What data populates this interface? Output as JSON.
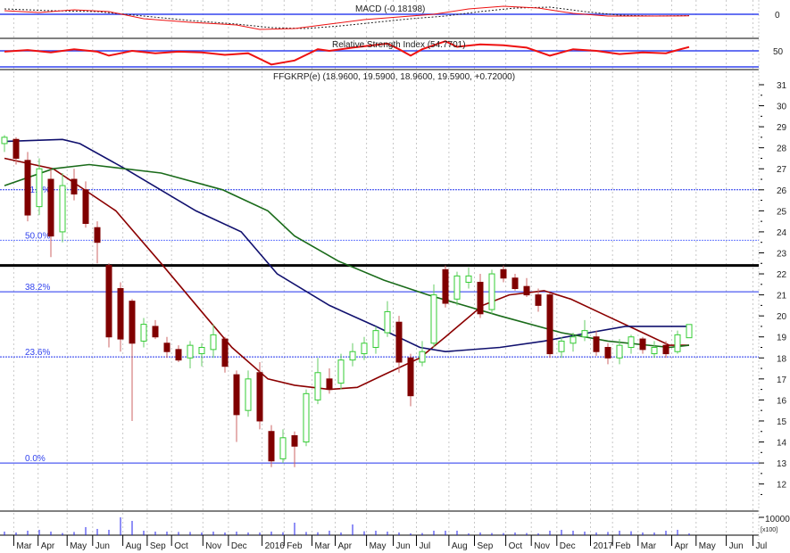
{
  "chart_data": {
    "type": "candlestick",
    "symbol_label": "FFGKRP(e) (18.9600, 19.5900, 18.9600, 19.5900, +0.72000)",
    "macd_label": "MACD (-0.18198)",
    "rsi_label": "Relative Strength Index (54.7701)",
    "price_axis": {
      "min": 12,
      "max": 31,
      "ticks": [
        12,
        13,
        14,
        15,
        16,
        17,
        18,
        19,
        20,
        21,
        22,
        23,
        24,
        25,
        26,
        27,
        28,
        29,
        30,
        31
      ]
    },
    "macd_axis": {
      "ticks": [
        {
          "label": "0",
          "value": 0
        }
      ]
    },
    "rsi_axis": {
      "ticks": [
        {
          "label": "50",
          "value": 50
        }
      ],
      "lines": [
        50,
        30
      ]
    },
    "volume_axis": {
      "tick_label": "10000",
      "tick_value": 10000,
      "unit_label": "[x100]"
    },
    "x_ticks": [
      [
        "Mar",
        0.8
      ],
      [
        "Apr",
        2.9
      ],
      [
        "May",
        5.4
      ],
      [
        "Jun",
        7.6
      ],
      [
        "Aug",
        10.2
      ],
      [
        "Sep",
        12.3
      ],
      [
        "Oct",
        14.4
      ],
      [
        "Nov",
        17.1
      ],
      [
        "Dec",
        19.3
      ],
      [
        "2016",
        22.2
      ],
      [
        "Feb",
        24.1
      ],
      [
        "Mar",
        26.5
      ],
      [
        "Apr",
        28.5
      ],
      [
        "May",
        31.2
      ],
      [
        "Jun",
        33.5
      ],
      [
        "Jul",
        35.5
      ],
      [
        "Aug",
        38.3
      ],
      [
        "Sep",
        40.5
      ],
      [
        "Oct",
        43.2
      ],
      [
        "Nov",
        45.4
      ],
      [
        "Dec",
        47.6
      ],
      [
        "2017",
        50.5
      ],
      [
        "Feb",
        52.4
      ],
      [
        "Mar",
        54.6
      ],
      [
        "Apr",
        57.5
      ],
      [
        "May",
        59.6
      ],
      [
        "Jun",
        62.2
      ],
      [
        "Jul",
        64.5
      ]
    ],
    "fibonacci": [
      {
        "label": "61.8%",
        "value": 26.0,
        "style": "dotted"
      },
      {
        "label": "50.0%",
        "value": 23.6,
        "style": "dotted-light"
      },
      {
        "label": "38.2%",
        "value": 21.15,
        "style": "solid"
      },
      {
        "label": "23.6%",
        "value": 18.05,
        "style": "dotted"
      },
      {
        "label": "0.0%",
        "value": 13.0,
        "style": "solid"
      }
    ],
    "resistance_line": 22.4,
    "candles_ohlc": [
      [
        28.2,
        28.6,
        27.8,
        28.5
      ],
      [
        28.4,
        28.5,
        27.2,
        27.5
      ],
      [
        27.4,
        27.8,
        24.5,
        24.8
      ],
      [
        25.2,
        27.5,
        24.8,
        27.0
      ],
      [
        26.5,
        27.0,
        22.8,
        23.8
      ],
      [
        24.0,
        26.8,
        23.5,
        26.2
      ],
      [
        26.5,
        27.0,
        25.5,
        25.8
      ],
      [
        26.0,
        26.4,
        24.2,
        24.4
      ],
      [
        24.2,
        24.5,
        22.5,
        23.5
      ],
      [
        22.4,
        22.5,
        18.5,
        19.0
      ],
      [
        21.3,
        21.6,
        18.3,
        18.9
      ],
      [
        20.7,
        20.8,
        15.0,
        18.7
      ],
      [
        18.8,
        19.9,
        18.5,
        19.6
      ],
      [
        19.5,
        19.8,
        18.9,
        19.0
      ],
      [
        18.7,
        19.0,
        18.0,
        18.3
      ],
      [
        18.4,
        18.6,
        17.8,
        17.9
      ],
      [
        18.0,
        18.8,
        17.5,
        18.6
      ],
      [
        18.2,
        18.7,
        17.6,
        18.5
      ],
      [
        18.4,
        19.6,
        18.0,
        19.1
      ],
      [
        18.9,
        19.0,
        17.3,
        17.6
      ],
      [
        17.2,
        17.4,
        14.0,
        15.3
      ],
      [
        15.5,
        17.4,
        15.2,
        17.0
      ],
      [
        17.3,
        17.8,
        14.6,
        15.0
      ],
      [
        14.5,
        14.8,
        12.8,
        13.1
      ],
      [
        13.2,
        14.6,
        13.0,
        14.2
      ],
      [
        14.3,
        14.5,
        12.8,
        13.8
      ],
      [
        14.0,
        16.5,
        13.8,
        16.3
      ],
      [
        16.0,
        18.0,
        15.8,
        17.3
      ],
      [
        17.0,
        17.5,
        16.3,
        16.5
      ],
      [
        16.8,
        18.2,
        16.5,
        17.9
      ],
      [
        17.9,
        18.7,
        17.6,
        18.3
      ],
      [
        18.2,
        19.0,
        17.9,
        18.7
      ],
      [
        18.5,
        19.5,
        18.2,
        19.3
      ],
      [
        19.2,
        20.7,
        19.0,
        20.2
      ],
      [
        19.7,
        20.0,
        17.3,
        17.8
      ],
      [
        18.0,
        18.2,
        15.7,
        16.2
      ],
      [
        17.8,
        18.8,
        17.6,
        18.3
      ],
      [
        18.7,
        21.5,
        18.5,
        21.0
      ],
      [
        22.2,
        22.4,
        20.4,
        20.6
      ],
      [
        20.8,
        22.1,
        20.5,
        21.9
      ],
      [
        21.6,
        22.3,
        21.3,
        21.9
      ],
      [
        21.6,
        22.0,
        19.9,
        20.1
      ],
      [
        20.3,
        22.2,
        20.1,
        22.0
      ],
      [
        22.2,
        22.4,
        21.6,
        21.8
      ],
      [
        21.8,
        22.0,
        21.2,
        21.3
      ],
      [
        21.4,
        21.8,
        20.9,
        21.0
      ],
      [
        21.0,
        21.3,
        20.2,
        20.5
      ],
      [
        21.0,
        21.1,
        18.0,
        18.2
      ],
      [
        18.3,
        19.0,
        18.0,
        18.8
      ],
      [
        18.7,
        19.2,
        18.3,
        19.0
      ],
      [
        19.0,
        19.8,
        18.8,
        19.3
      ],
      [
        19.0,
        19.3,
        18.1,
        18.3
      ],
      [
        18.5,
        18.7,
        17.7,
        18.0
      ],
      [
        18.0,
        18.9,
        17.7,
        18.6
      ],
      [
        18.5,
        19.1,
        18.2,
        19.0
      ],
      [
        18.9,
        19.0,
        18.2,
        18.4
      ],
      [
        18.2,
        18.8,
        18.0,
        18.5
      ],
      [
        18.6,
        18.8,
        18.0,
        18.2
      ],
      [
        18.3,
        19.3,
        18.2,
        19.1
      ],
      [
        18.96,
        19.59,
        18.96,
        19.59
      ]
    ],
    "moving_averages": [
      {
        "name": "short",
        "color": "#8b0000",
        "points": [
          [
            0,
            27.5
          ],
          [
            4.2,
            27
          ],
          [
            9.6,
            25
          ],
          [
            13.5,
            22.5
          ],
          [
            17.3,
            20
          ],
          [
            19.6,
            18.5
          ],
          [
            22.7,
            17
          ],
          [
            25,
            16.7
          ],
          [
            28,
            16.5
          ],
          [
            30.4,
            16.6
          ],
          [
            32.7,
            17.2
          ],
          [
            35.8,
            18
          ],
          [
            38,
            19
          ],
          [
            41.2,
            20.5
          ],
          [
            43.5,
            21
          ],
          [
            46.5,
            21.2
          ],
          [
            48.8,
            20.8
          ],
          [
            51.9,
            20
          ],
          [
            55,
            19.2
          ],
          [
            57.3,
            18.6
          ],
          [
            59,
            18.6
          ]
        ]
      },
      {
        "name": "medium",
        "color": "#10106e",
        "points": [
          [
            0,
            28.3
          ],
          [
            5,
            28.4
          ],
          [
            6.5,
            28.2
          ],
          [
            10.4,
            27
          ],
          [
            16.5,
            25
          ],
          [
            20.4,
            24
          ],
          [
            23.5,
            22
          ],
          [
            28,
            20.5
          ],
          [
            32,
            19.5
          ],
          [
            35.8,
            18.5
          ],
          [
            38,
            18.3
          ],
          [
            42.7,
            18.5
          ],
          [
            46.5,
            18.8
          ],
          [
            50.4,
            19.2
          ],
          [
            53.5,
            19.5
          ],
          [
            59,
            19.5
          ]
        ]
      },
      {
        "name": "long",
        "color": "#1a6b1a",
        "points": [
          [
            0,
            26.2
          ],
          [
            4.2,
            27
          ],
          [
            7.3,
            27.2
          ],
          [
            13.5,
            26.8
          ],
          [
            18.8,
            26
          ],
          [
            22.7,
            25
          ],
          [
            25,
            23.8
          ],
          [
            28.8,
            22.6
          ],
          [
            32.7,
            21.7
          ],
          [
            36.5,
            21
          ],
          [
            42.7,
            20
          ],
          [
            48,
            19.2
          ],
          [
            52,
            18.8
          ],
          [
            57.3,
            18.5
          ],
          [
            59,
            18.6
          ]
        ]
      }
    ],
    "macd": [
      [
        0,
        0.4
      ],
      [
        3,
        0.2
      ],
      [
        6,
        0.5
      ],
      [
        9,
        0.3
      ],
      [
        12,
        -0.5
      ],
      [
        16,
        -0.9
      ],
      [
        20,
        -1.2
      ],
      [
        22,
        -1.7
      ],
      [
        25,
        -1.6
      ],
      [
        28,
        -1.1
      ],
      [
        31,
        -0.6
      ],
      [
        34,
        -0.3
      ],
      [
        37,
        0
      ],
      [
        40,
        0.6
      ],
      [
        43,
        0.9
      ],
      [
        46,
        0.7
      ],
      [
        49,
        0.1
      ],
      [
        52,
        -0.2
      ],
      [
        55,
        -0.2
      ],
      [
        59,
        -0.18
      ]
    ],
    "macd_signal": [
      [
        0,
        0.6
      ],
      [
        4,
        0.4
      ],
      [
        8,
        0.3
      ],
      [
        12,
        -0.2
      ],
      [
        16,
        -0.7
      ],
      [
        20,
        -1.1
      ],
      [
        23,
        -1.5
      ],
      [
        26,
        -1.6
      ],
      [
        29,
        -1.3
      ],
      [
        32,
        -0.9
      ],
      [
        35,
        -0.5
      ],
      [
        38,
        -0.2
      ],
      [
        41,
        0.3
      ],
      [
        44,
        0.7
      ],
      [
        47,
        0.8
      ],
      [
        50,
        0.3
      ],
      [
        53,
        -0.1
      ],
      [
        56,
        -0.2
      ],
      [
        59,
        -0.15
      ]
    ],
    "rsi": [
      [
        0,
        49
      ],
      [
        2,
        51
      ],
      [
        4,
        48
      ],
      [
        6,
        52
      ],
      [
        8,
        49
      ],
      [
        9,
        44
      ],
      [
        11,
        50
      ],
      [
        13,
        47
      ],
      [
        15,
        49
      ],
      [
        17,
        48
      ],
      [
        19,
        45
      ],
      [
        21,
        47
      ],
      [
        22,
        40
      ],
      [
        23,
        33
      ],
      [
        25,
        38
      ],
      [
        26,
        45
      ],
      [
        27,
        52
      ],
      [
        28,
        50
      ],
      [
        30,
        54
      ],
      [
        33,
        59
      ],
      [
        34,
        52
      ],
      [
        35,
        44
      ],
      [
        36,
        52
      ],
      [
        38,
        62
      ],
      [
        39,
        55
      ],
      [
        41,
        58
      ],
      [
        43,
        57
      ],
      [
        45,
        54
      ],
      [
        47,
        44
      ],
      [
        49,
        52
      ],
      [
        51,
        50
      ],
      [
        53,
        46
      ],
      [
        55,
        48
      ],
      [
        57,
        47
      ],
      [
        58,
        51
      ],
      [
        59,
        54.77
      ]
    ],
    "volume": [
      2000,
      1500,
      2500,
      3000,
      2000,
      1200,
      1800,
      4500,
      3500,
      3000,
      10000,
      8000,
      2500,
      2000,
      2000,
      1800,
      1800,
      1500,
      2000,
      1500,
      2000,
      1500,
      1500,
      2000,
      1600,
      7000,
      1800,
      1600,
      2500,
      1500,
      6000,
      2200,
      2500,
      2000,
      1500,
      1000,
      1200,
      2500,
      2500,
      2500,
      1000,
      1500,
      1200,
      1200,
      1500,
      1200,
      1000,
      2500,
      3000,
      2500,
      2000,
      1500,
      1800,
      2500,
      2200,
      1500,
      1500,
      2500,
      3000,
      1000
    ],
    "colors": {
      "up": "#33cc33",
      "down": "#800000",
      "fib": "#2233ee",
      "macd": "#ee1111",
      "rsi": "#ee1111",
      "volume": "#2222ee"
    }
  }
}
